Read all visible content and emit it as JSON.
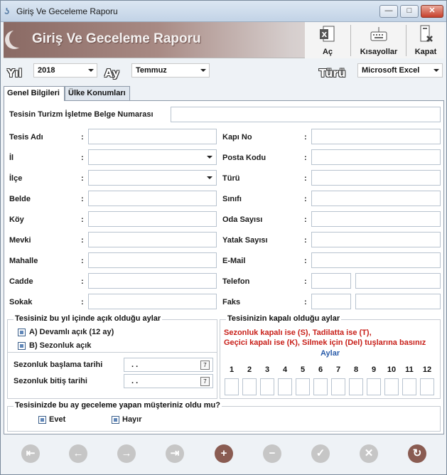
{
  "window": {
    "title": "Giriş Ve Geceleme Raporu",
    "app_icon": "s5-logo"
  },
  "header": {
    "title": "Giriş Ve Geceleme Raporu",
    "buttons": [
      {
        "label": "Aç",
        "icon": "excel-icon"
      },
      {
        "label": "Kısayollar",
        "icon": "keyboard-icon"
      },
      {
        "label": "Kapat",
        "icon": "close-app-icon"
      }
    ]
  },
  "filters": {
    "year_label": "Yıl",
    "year_value": "2018",
    "month_label": "Ay",
    "month_value": "Temmuz",
    "type_label": "Türü",
    "type_value": "Microsoft Excel"
  },
  "tabs": [
    {
      "label": "Genel Bilgileri"
    },
    {
      "label": "Ülke Konumları"
    }
  ],
  "form": {
    "belge_label": "Tesisin Turizm İşletme Belge Numarası",
    "colon": ":",
    "left_fields": [
      "Tesis Adı",
      "İl",
      "İlçe",
      "Belde",
      "Köy",
      "Mevki",
      "Mahalle",
      "Cadde",
      "Sokak"
    ],
    "right_fields": [
      "Kapı No",
      "Posta Kodu",
      "Türü",
      "Sınıfı",
      "Oda Sayısı",
      "Yatak Sayısı",
      "E-Mail",
      "Telefon",
      "Faks"
    ]
  },
  "open_months": {
    "title": "Tesisiniz bu yıl içinde açık olduğu aylar",
    "opt_a": "A) Devamlı açık (12 ay)",
    "opt_b": "B) Sezonluk açık",
    "start_label": "Sezonluk başlama tarihi",
    "end_label": "Sezonluk bitiş tarihi",
    "date_placeholder": ". ."
  },
  "closed_months": {
    "title": "Tesisinizin kapalı olduğu aylar",
    "hint1": "Sezonluk kapalı ise (S), Tadilatta ise (T),",
    "hint2": "Geçici kapalı ise (K), Silmek için (Del) tuşlarına basınız",
    "months_label": "Aylar",
    "months": [
      "1",
      "2",
      "3",
      "4",
      "5",
      "6",
      "7",
      "8",
      "9",
      "10",
      "11",
      "12"
    ]
  },
  "guest": {
    "question": "Tesisinizde bu ay geceleme yapan müşteriniz oldu mu?",
    "yes": "Evet",
    "no": "Hayır"
  },
  "colors": {
    "accent": "#8a5c52",
    "red_text": "#c8201a",
    "link_blue": "#2a5caa"
  }
}
